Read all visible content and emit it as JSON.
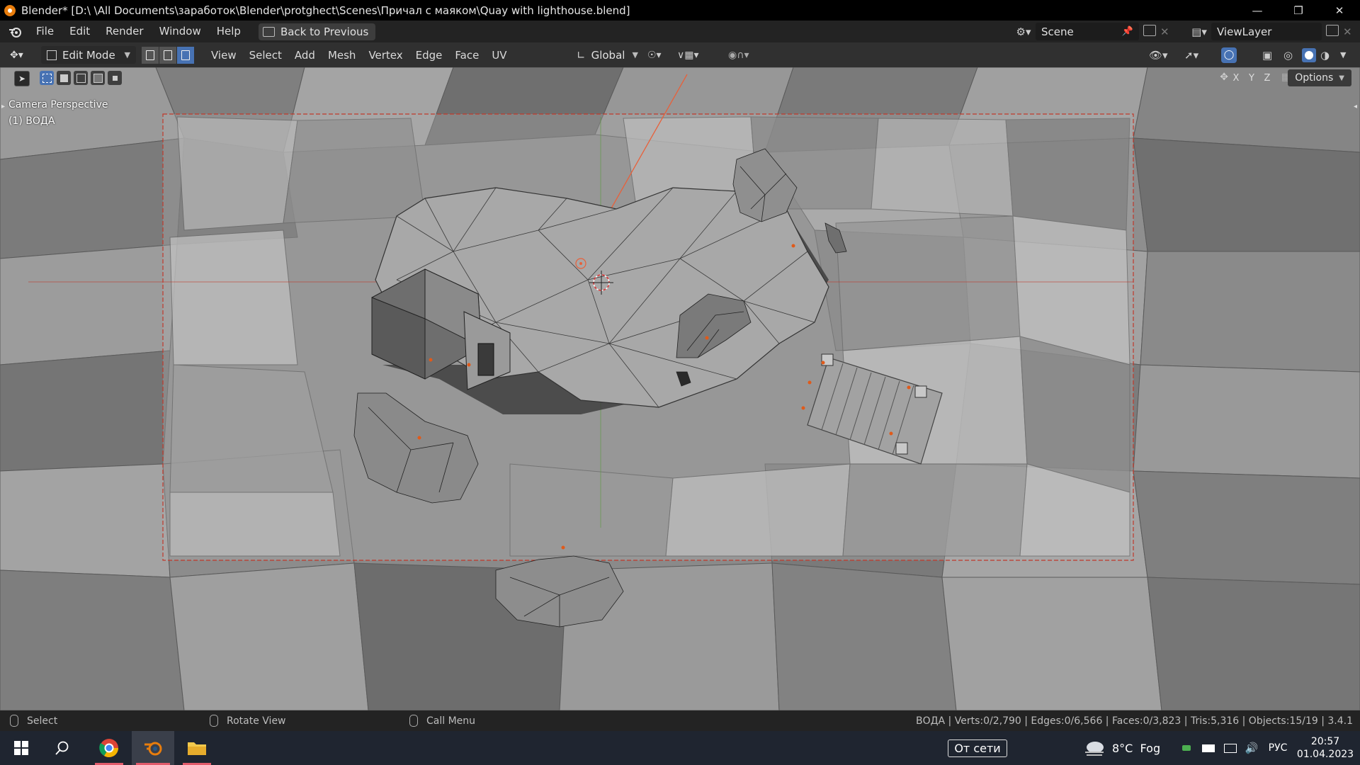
{
  "window": {
    "title": "Blender* [D:\\ \\All Documents\\заработок\\Blender\\protghect\\Scenes\\Причал с маяком\\Quay with lighthouse.blend]",
    "controls": [
      "—",
      "❐",
      "✕"
    ]
  },
  "menubar": {
    "items": [
      "File",
      "Edit",
      "Render",
      "Window",
      "Help"
    ],
    "back_button": "Back to Previous",
    "scene_label": "Scene",
    "view_layer_label": "ViewLayer"
  },
  "header": {
    "mode": "Edit Mode",
    "menus": [
      "View",
      "Select",
      "Add",
      "Mesh",
      "Vertex",
      "Edge",
      "Face",
      "UV"
    ],
    "transform_orientation": "Global",
    "select_mode_active": "face"
  },
  "viewport": {
    "overlay_line1": "Camera Perspective",
    "overlay_line2": "(1) ВОДА",
    "options_label": "Options",
    "axes": [
      "X",
      "Y",
      "Z"
    ]
  },
  "statusbar": {
    "left_hint": "Select",
    "middle_hint": "Rotate View",
    "right_hint": "Call Menu",
    "stats": "ВОДА | Verts:0/2,790 | Edges:0/6,566 | Faces:0/3,823 | Tris:5,316 | Objects:15/19 | 3.4.1"
  },
  "taskbar": {
    "network_status": "От сети",
    "weather": "8°C  Fog",
    "language": "РУС",
    "time": "20:57",
    "date": "01.04.2023"
  },
  "colors": {
    "accent_blue": "#4772b3",
    "blender_orange": "#e87d0d",
    "camera_frame": "#c0392b"
  }
}
